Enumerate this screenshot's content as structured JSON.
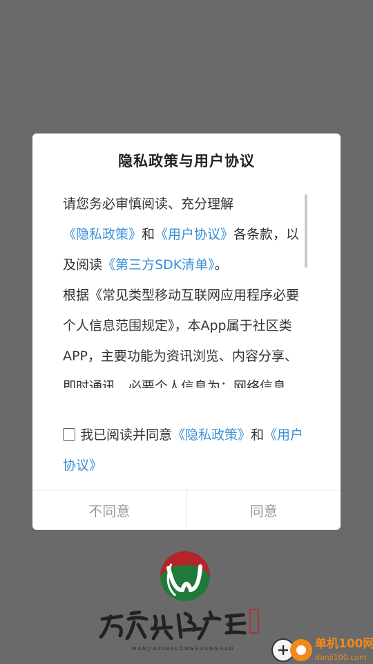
{
  "dialog": {
    "title": "隐私政策与用户协议",
    "paragraph1": {
      "text_before": "请您务必审慎阅读、充分理解",
      "link1": "《隐私政策》",
      "and": "和",
      "link2": "《用户协议》",
      "text_middle": "各条款，以及阅读",
      "link3": "《第三方SDK清单》",
      "text_after": "。"
    },
    "paragraph2": "根据《常见类型移动互联网应用程序必要个人信息范围规定》，本App属于社区类APP，主要功能为资讯浏览、内容分享、即时通讯，必要个人信息为：网络信息",
    "agree": {
      "text": "我已阅读并同意",
      "link1": "《隐私政策》",
      "and": "和",
      "link2": "《用户协议》",
      "checked": false
    },
    "buttons": {
      "disagree": "不同意",
      "agree": "同意"
    }
  },
  "logo": {
    "name": "万家兴隆广告",
    "pinyin": "WANJIAXINGLONGGUANGGAO",
    "seal": "万家兴隆"
  },
  "watermark": {
    "name": "单机100网",
    "url": "danji100.com"
  },
  "colors": {
    "overlay": "#6a6a6a",
    "link": "#3a8fd6",
    "button_text": "#9a9a9a"
  }
}
